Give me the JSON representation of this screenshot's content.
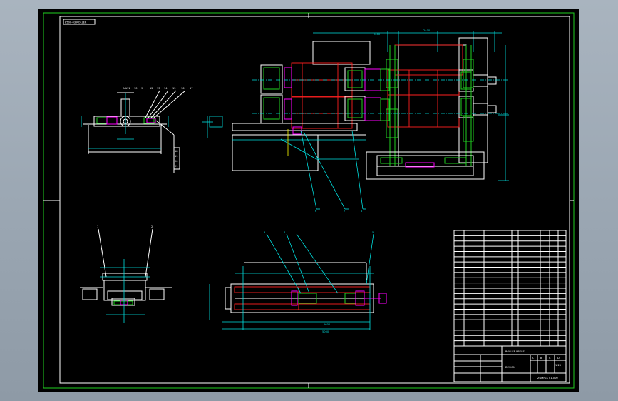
{
  "drawing": {
    "stamp": "8500-03-ROLLER",
    "title_block": {
      "main_title": "ROLLER PRESS",
      "unit": "DESIGN",
      "drawing_no": "ZGMPLS 01-000",
      "scale": "1:20",
      "sheet_marks": [
        "A",
        "B",
        "C",
        "D"
      ]
    },
    "balloons_top": [
      "11",
      "10",
      "9",
      "12",
      "13",
      "14",
      "15",
      "16",
      "17"
    ],
    "balloons_right": [
      "18",
      "19",
      "20",
      "21"
    ],
    "balloons_main": [
      "6",
      "7",
      "8"
    ],
    "balloons_bottom": [
      "1",
      "2",
      "3",
      "4",
      "5"
    ],
    "section_label": "A-A",
    "bom_rows": 22
  },
  "colors": {
    "frame": "#1fd11f",
    "background": "#000000",
    "roll": "#ff2020",
    "part": "#ff00ff",
    "dimension": "#00e0e0"
  }
}
